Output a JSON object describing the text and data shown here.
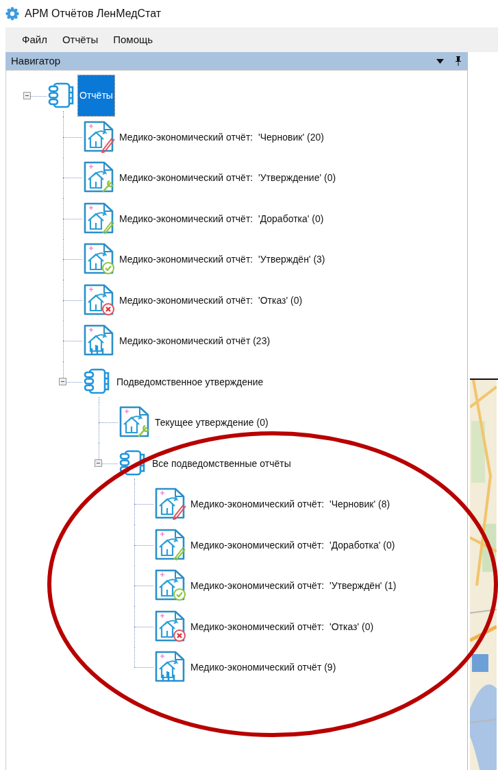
{
  "window": {
    "title": "АРМ Отчётов ЛенМедСтат"
  },
  "menu": [
    {
      "label": "Файл"
    },
    {
      "label": "Отчёты"
    },
    {
      "label": "Помощь"
    }
  ],
  "navigator": {
    "title": "Навигатор"
  },
  "tree": [
    {
      "label": "Отчёты",
      "kind": "group",
      "expanded": true,
      "selected": true,
      "children": [
        {
          "label": "Медико-экономический отчёт:  'Черновик' (20)",
          "kind": "draft",
          "selected": false
        },
        {
          "label": "Медико-экономический отчёт:  'Утверждение' (0)",
          "kind": "approval",
          "selected": false
        },
        {
          "label": "Медико-экономический отчёт:  'Доработка' (0)",
          "kind": "revision",
          "selected": false
        },
        {
          "label": "Медико-экономический отчёт:  'Утверждён' (3)",
          "kind": "approved",
          "selected": false
        },
        {
          "label": "Медико-экономический отчёт:  'Отказ' (0)",
          "kind": "rejected",
          "selected": false
        },
        {
          "label": "Медико-экономический отчёт (23)",
          "kind": "total",
          "selected": false
        },
        {
          "label": "Подведомственное утверждение",
          "kind": "group",
          "expanded": true,
          "selected": false,
          "children": [
            {
              "label": "Текущее утверждение (0)",
              "kind": "approval",
              "selected": false
            },
            {
              "label": "Все подведомственные отчёты",
              "kind": "group",
              "expanded": true,
              "selected": false,
              "children": [
                {
                  "label": "Медико-экономический отчёт:  'Черновик' (8)",
                  "kind": "draft",
                  "selected": false
                },
                {
                  "label": "Медико-экономический отчёт:  'Доработка' (0)",
                  "kind": "revision",
                  "selected": false
                },
                {
                  "label": "Медико-экономический отчёт:  'Утверждён' (1)",
                  "kind": "approved",
                  "selected": false
                },
                {
                  "label": "Медико-экономический отчёт:  'Отказ' (0)",
                  "kind": "rejected",
                  "selected": false
                },
                {
                  "label": "Медико-экономический отчёт (9)",
                  "kind": "total",
                  "selected": false
                }
              ]
            }
          ]
        }
      ]
    }
  ],
  "annotation": {
    "kind": "ellipse"
  }
}
